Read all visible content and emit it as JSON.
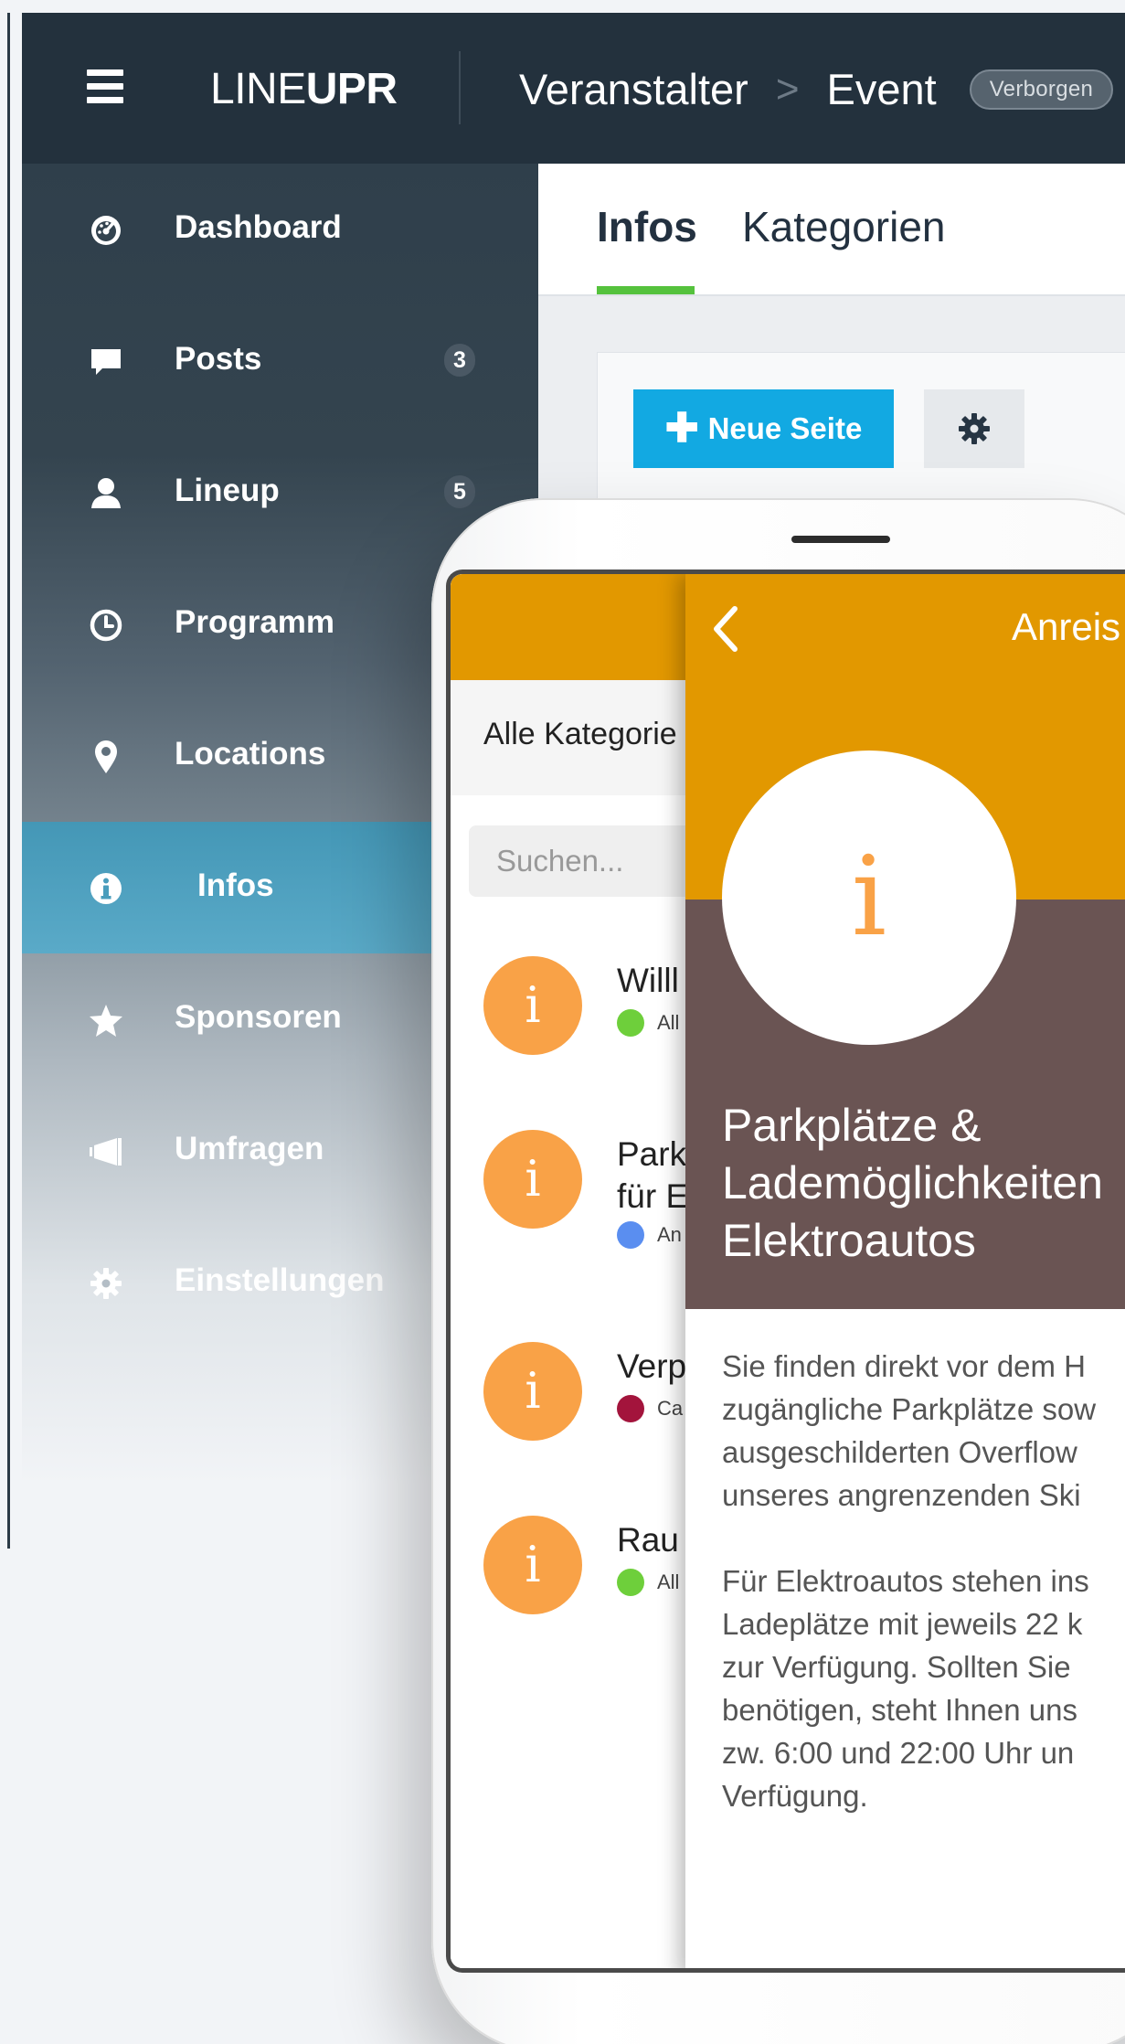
{
  "header": {
    "brand_light": "LINE",
    "brand_bold": "UPR",
    "breadcrumb": [
      "Veranstalter",
      "Event"
    ],
    "breadcrumb_separator": ">",
    "visibility_badge": "Verborgen"
  },
  "sidebar": {
    "items": [
      {
        "label": "Dashboard",
        "icon": "dashboard-icon"
      },
      {
        "label": "Posts",
        "icon": "comment-icon",
        "count": "3"
      },
      {
        "label": "Lineup",
        "icon": "user-icon",
        "count": "5"
      },
      {
        "label": "Programm",
        "icon": "clock-icon"
      },
      {
        "label": "Locations",
        "icon": "map-pin-icon"
      },
      {
        "label": "Infos",
        "icon": "info-icon",
        "active": true
      },
      {
        "label": "Sponsoren",
        "icon": "star-icon"
      },
      {
        "label": "Umfragen",
        "icon": "megaphone-icon"
      },
      {
        "label": "Einstellungen",
        "icon": "gear-icon"
      }
    ]
  },
  "content": {
    "tabs": [
      {
        "label": "Infos",
        "active": true
      },
      {
        "label": "Kategorien"
      }
    ],
    "new_page_label": "Neue Seite"
  },
  "phone": {
    "list": {
      "filter": "Alle Kategorie",
      "search_placeholder": "Suchen...",
      "items": [
        {
          "title": "Willl",
          "category": "All",
          "dot_color": "#6ecf3b"
        },
        {
          "title": "Park\nfür E",
          "category": "An",
          "dot_color": "#5a8ef0"
        },
        {
          "title": "Verp",
          "category": "Ca",
          "dot_color": "#a3143c"
        },
        {
          "title": "Rau",
          "category": "All",
          "dot_color": "#6ecf3b"
        }
      ]
    },
    "detail": {
      "header_title": "Anreis",
      "heading": "Parkplätze &\nLademöglichkeiten\nElektroautos",
      "body": "Sie finden direkt vor dem H\nzugängliche Parkplätze sow\nausgeschilderten Overflow\nunseres angrenzenden Ski\n\nFür Elektroautos stehen ins\nLadeplätze mit jeweils 22 k\nzur Verfügung. Sollten Sie \nbenötigen, steht Ihnen uns\nzw. 6:00 und 22:00 Uhr un\nVerfügung."
    }
  },
  "colors": {
    "topbar": "#23313d",
    "accent_blue": "#12a9e2",
    "tab_underline": "#55c23d",
    "app_orange": "#e29800",
    "info_badge": "#f9a247",
    "hero_brown": "#6a5453"
  }
}
